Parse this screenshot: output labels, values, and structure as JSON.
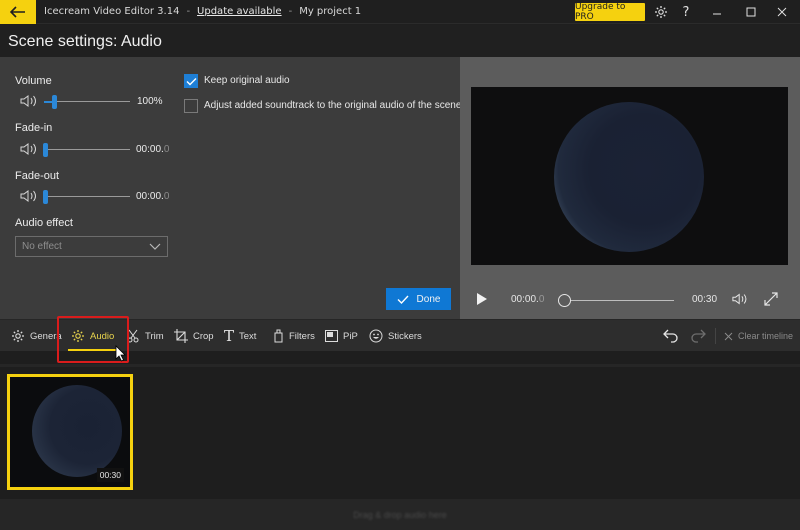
{
  "titlebar": {
    "app_name": "Icecream Video Editor 3.14",
    "separator": "-",
    "update_link": "Update available",
    "project_name": "My project 1",
    "upgrade_label": "Upgrade to PRO",
    "icons": [
      "back-arrow-icon",
      "gear-icon",
      "help-icon",
      "minimize-icon",
      "maximize-icon",
      "close-icon"
    ]
  },
  "page": {
    "title": "Scene settings: Audio"
  },
  "settings": {
    "volume": {
      "label": "Volume",
      "value_text": "100%",
      "level_fraction": 0.12
    },
    "fade_in": {
      "label": "Fade-in",
      "value_main": "00:00.",
      "value_dim": "0",
      "level_fraction": 0
    },
    "fade_out": {
      "label": "Fade-out",
      "value_main": "00:00.",
      "value_dim": "0",
      "level_fraction": 0
    },
    "audio_effect": {
      "label": "Audio effect",
      "selected": "No effect"
    },
    "keep_original": {
      "label": "Keep original audio",
      "checked": true
    },
    "adjust_soundtrack": {
      "label": "Adjust added soundtrack to the original audio of the scene",
      "checked": false
    },
    "done_label": "Done"
  },
  "player": {
    "current_main": "00:00.",
    "current_dim": "0",
    "duration": "00:30",
    "progress_fraction": 0
  },
  "toolbar": {
    "tools": [
      {
        "label": "Genera",
        "icon": "gear-icon"
      },
      {
        "label": "Audio",
        "icon": "gear-icon",
        "active": true
      },
      {
        "label": "Trim",
        "icon": "scissors-icon"
      },
      {
        "label": "Crop",
        "icon": "crop-icon"
      },
      {
        "label": "Text",
        "icon": "text-icon"
      },
      {
        "label": "Filters",
        "icon": "filter-icon"
      },
      {
        "label": "PiP",
        "icon": "pip-icon"
      },
      {
        "label": "Stickers",
        "icon": "smiley-icon"
      }
    ],
    "clear_label": "Clear timeline"
  },
  "timeline": {
    "clip_duration": "00:30",
    "audio_drop_text": "Drag & drop audio here"
  },
  "colors": {
    "accent_yellow": "#f5d10f",
    "accent_blue": "#0f78d4",
    "highlight_red": "#d91c1c"
  }
}
